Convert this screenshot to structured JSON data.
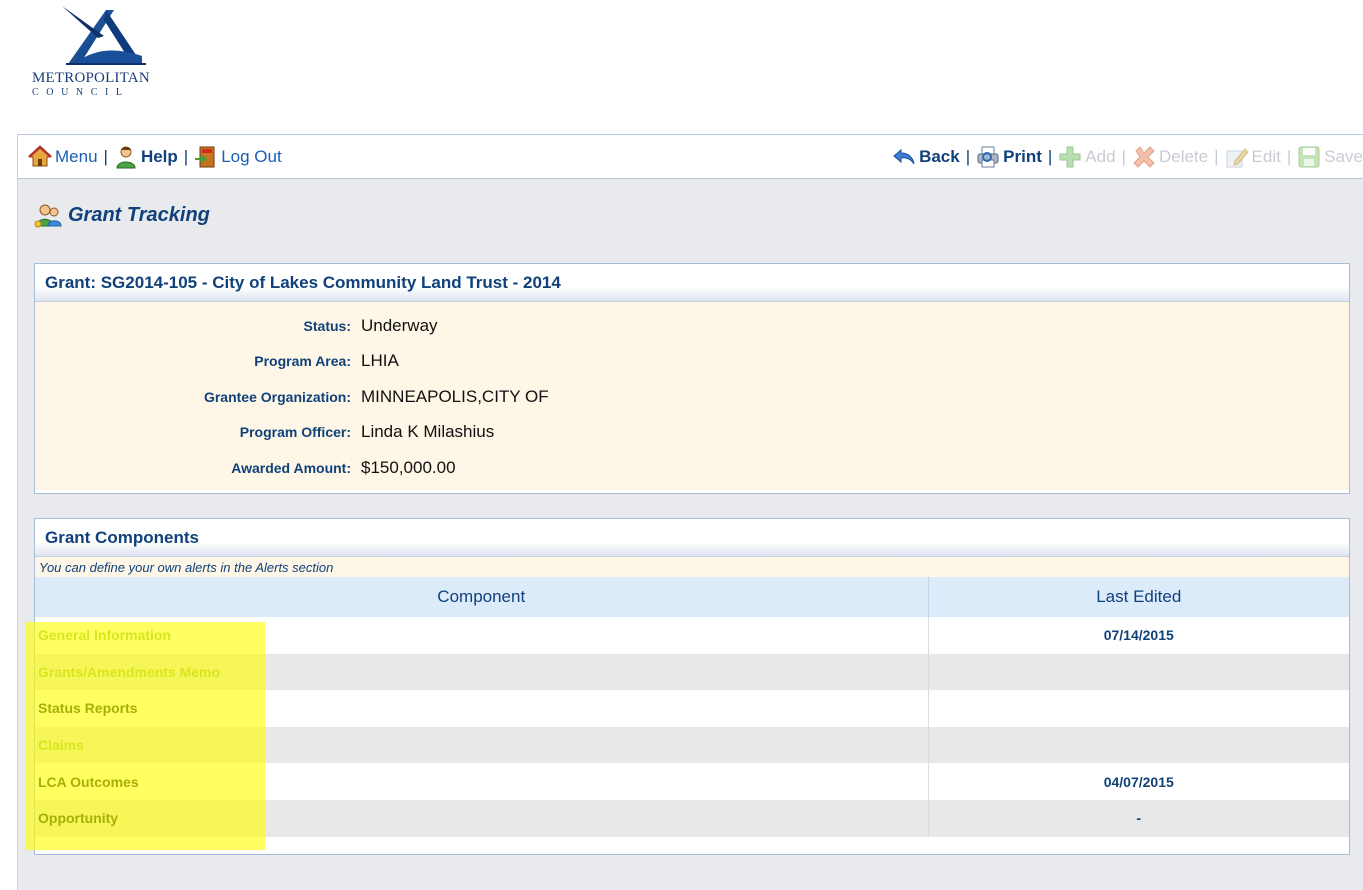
{
  "logo": {
    "title": "METROPOLITAN",
    "subtitle": "COUNCIL"
  },
  "toolbar": {
    "menu": "Menu",
    "help": "Help",
    "logout": "Log Out",
    "back": "Back",
    "print": "Print",
    "add": "Add",
    "delete": "Delete",
    "edit": "Edit",
    "save": "Save",
    "separator": "|"
  },
  "page": {
    "title": "Grant Tracking"
  },
  "grant": {
    "header": "Grant: SG2014-105 - City of Lakes Community Land Trust - 2014",
    "fields": [
      {
        "label": "Status:",
        "value": "Underway"
      },
      {
        "label": "Program Area:",
        "value": "LHIA"
      },
      {
        "label": "Grantee Organization:",
        "value": "MINNEAPOLIS,CITY OF"
      },
      {
        "label": "Program Officer:",
        "value": "Linda K Milashius"
      },
      {
        "label": "Awarded Amount:",
        "value": "$150,000.00"
      }
    ]
  },
  "components": {
    "header": "Grant Components",
    "note": "You can define your own alerts in the Alerts section",
    "columns": {
      "component": "Component",
      "last_edited": "Last Edited"
    },
    "rows": [
      {
        "name": "General Information",
        "last_edited": "07/14/2015"
      },
      {
        "name": "Grants/Amendments Memo",
        "last_edited": ""
      },
      {
        "name": "Status Reports",
        "last_edited": ""
      },
      {
        "name": "Claims",
        "last_edited": ""
      },
      {
        "name": "LCA Outcomes",
        "last_edited": "04/07/2015"
      },
      {
        "name": "Opportunity",
        "last_edited": "-"
      }
    ]
  },
  "colors": {
    "brand_blue": "#10417a",
    "link_blue": "#1a5fb4",
    "highlight": "#ffff00",
    "disabled_link": "#9cbc4c"
  }
}
